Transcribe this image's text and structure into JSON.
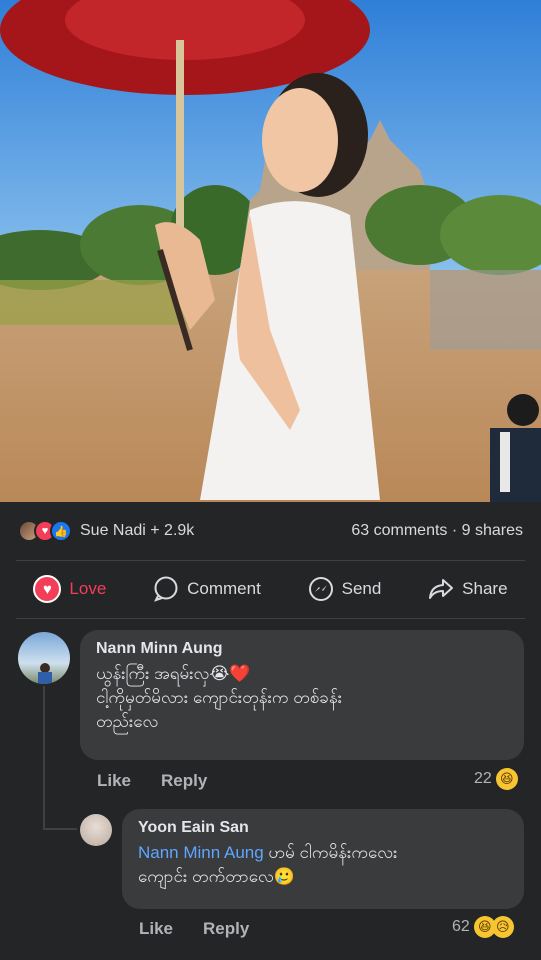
{
  "post": {
    "reactions_text": "Sue Nadi + 2.9k",
    "counts_text": "63 comments · 9 shares"
  },
  "actions": {
    "love": "Love",
    "comment": "Comment",
    "send": "Send",
    "share": "Share"
  },
  "comments": [
    {
      "author": "Nann Minn Aung",
      "line1": "ယွန်းကြီး အရမ်းလှ😭❤️",
      "line2": "ငါ့ကိုမှတ်မိလား ကျောင်းတုန်းက တစ်ခန်း",
      "line3": "တည်းလေ",
      "like": "Like",
      "reply": "Reply",
      "count": "22"
    },
    {
      "author": "Yoon Eain San",
      "mention": "Nann Minn Aung",
      "line1_rest": " ဟမ် ငါကမိန်းကလေး",
      "line2": "ကျောင်း တက်တာလေ🥲",
      "like": "Like",
      "reply": "Reply",
      "count": "62"
    }
  ],
  "colors": {
    "background": "#242526",
    "bubble": "#3a3b3c",
    "love": "#f33e58",
    "like": "#1877f2",
    "mention": "#5fa6ff"
  }
}
